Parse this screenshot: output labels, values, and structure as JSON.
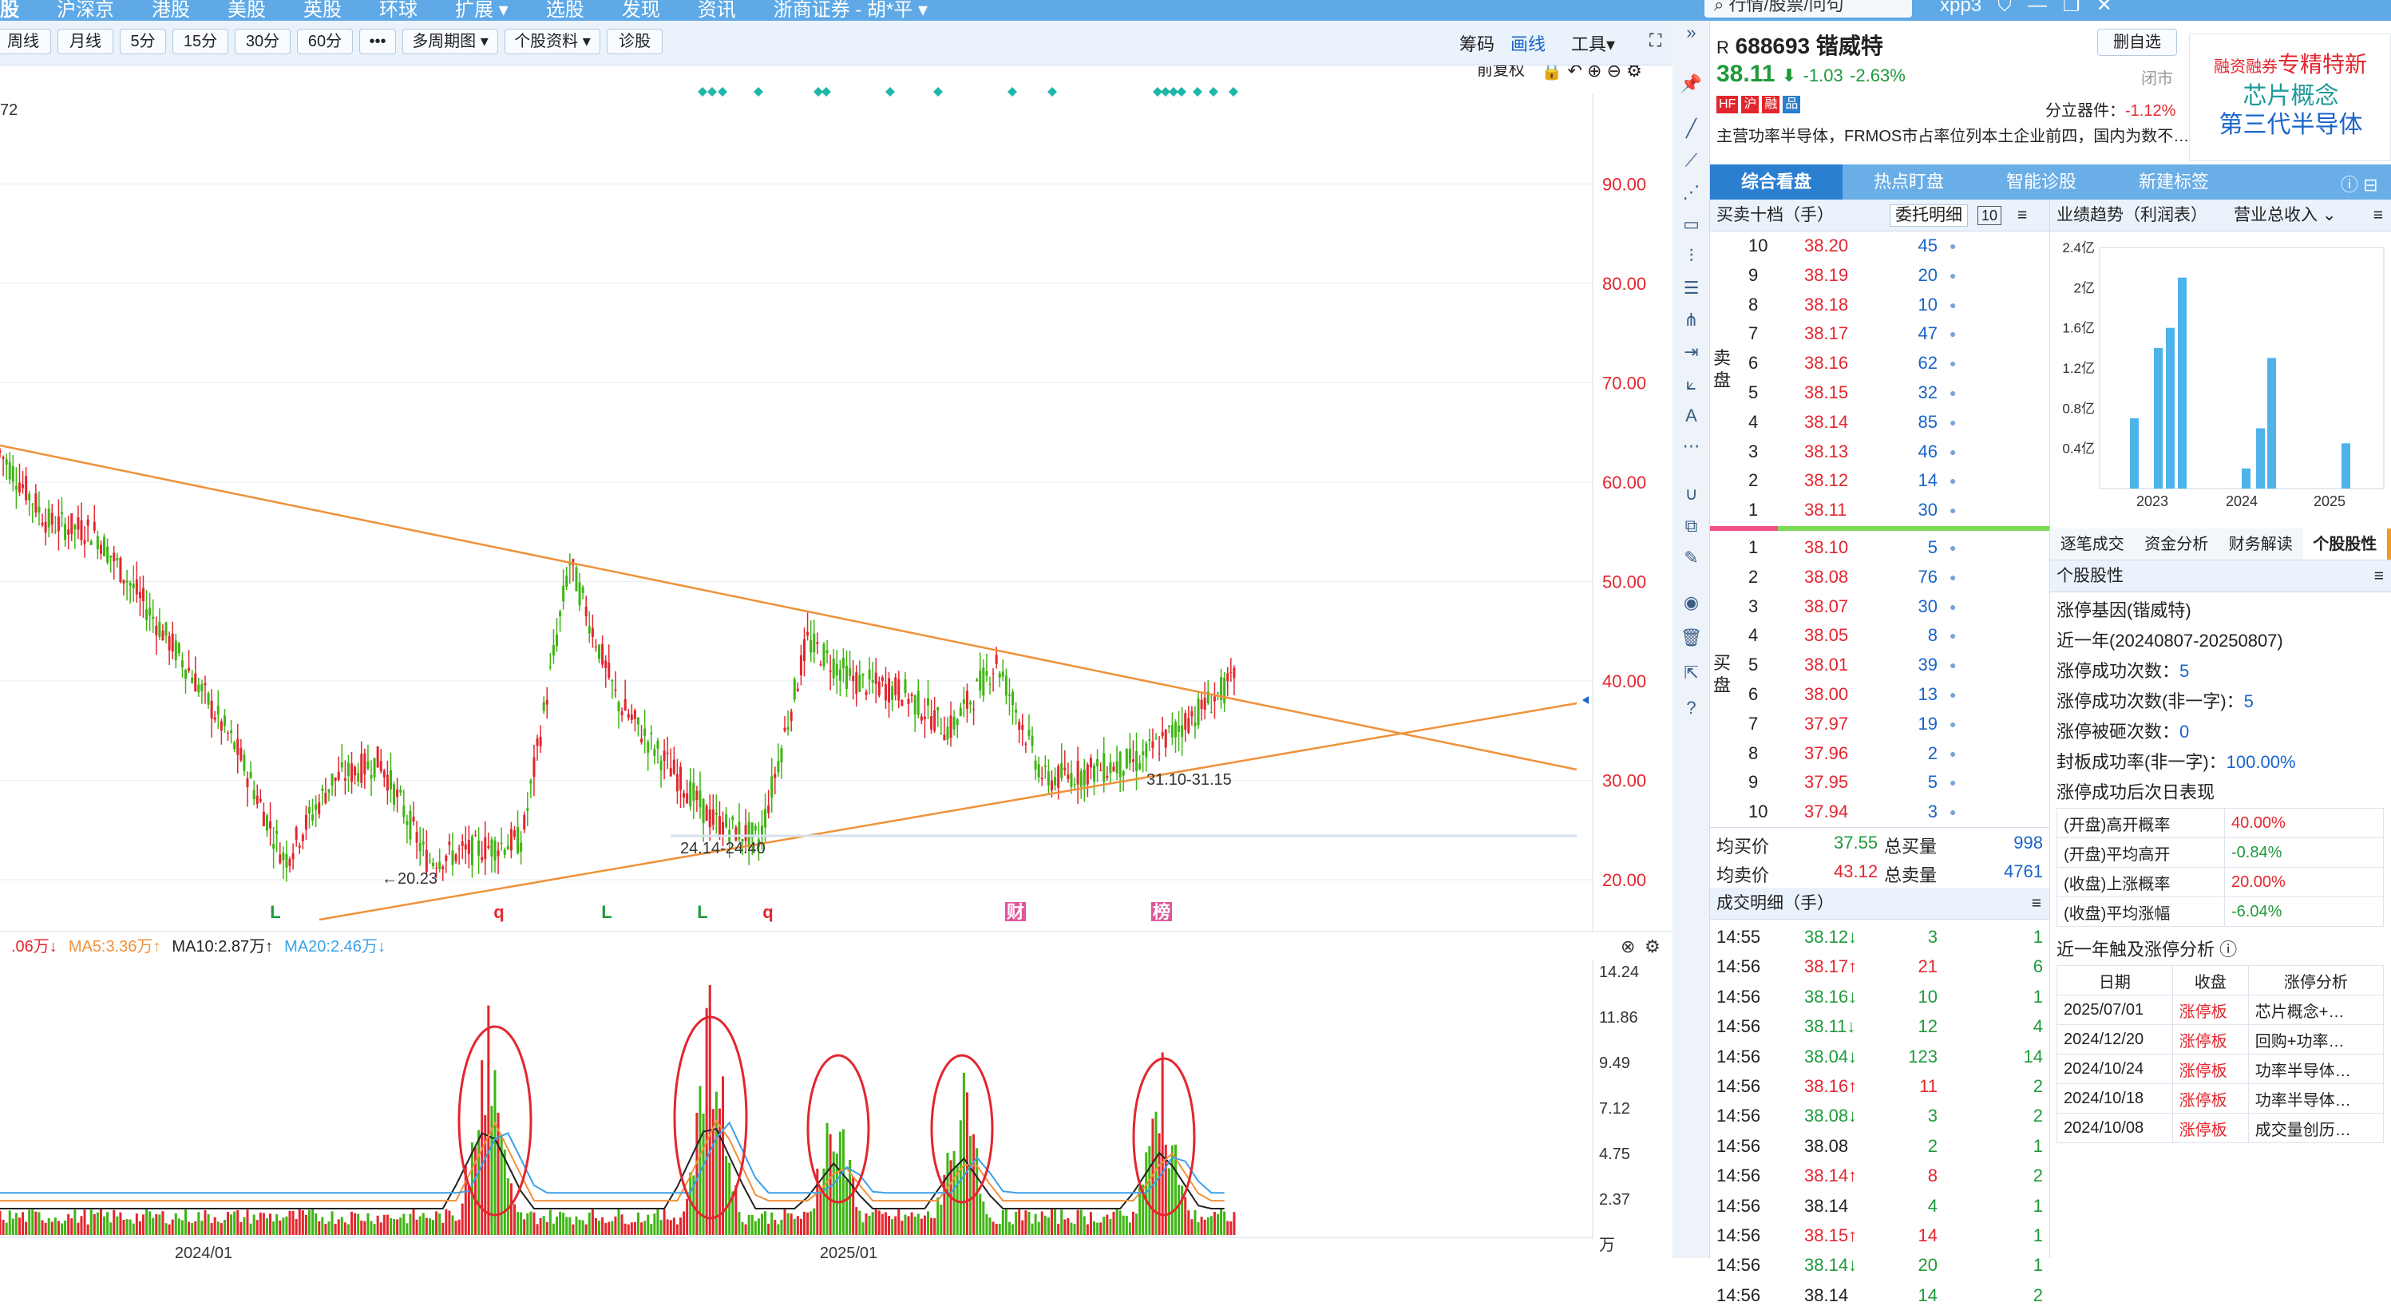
{
  "nav": {
    "items": [
      "股",
      "沪深京",
      "港股",
      "美股",
      "英股",
      "环球",
      "扩展 ▾",
      "选股",
      "发现",
      "资讯",
      "浙商证券 - 胡*平 ▾"
    ],
    "search_placeholder": "行情/股票/问句",
    "user": "xpp3"
  },
  "toolbar": {
    "periods": [
      "周线",
      "月线",
      "5分",
      "15分",
      "30分",
      "60分",
      "•••",
      "多周期图 ▾",
      "个股资料 ▾",
      "诊股"
    ],
    "right": [
      "筹码",
      "画线",
      "工具▾"
    ],
    "restore": "前复权"
  },
  "chart": {
    "top_left_label": "72",
    "price_ticks": [
      "90.00",
      "80.00",
      "70.00",
      "60.00",
      "50.00",
      "40.00",
      "30.00",
      "20.00"
    ],
    "annotations": [
      "←20.23",
      "24.14-24.40",
      "31.10-31.15"
    ],
    "markers": [
      "L",
      "q",
      "L",
      "L",
      "q",
      "财",
      "榜"
    ],
    "ma_text": {
      "a": ".06万↓",
      "ma5": "MA5:3.36万↑",
      "ma10": "MA10:2.87万↑",
      "ma20": "MA20:2.46万↓"
    },
    "vol_ticks": [
      "14.24",
      "11.86",
      "9.49",
      "7.12",
      "4.75",
      "2.37",
      "万"
    ],
    "date_labels": [
      "2024/01",
      "2025/01"
    ]
  },
  "chart_data": {
    "type": "line",
    "title": "",
    "x": [
      "2023-06",
      "2023-07",
      "2023-08",
      "2023-09",
      "2023-10",
      "2023-11",
      "2023-12",
      "2024-01",
      "2024-02",
      "2024-03",
      "2024-04",
      "2024-05",
      "2024-06",
      "2024-07",
      "2024-08",
      "2024-09",
      "2024-10",
      "2024-11",
      "2024-12",
      "2025-01",
      "2025-02",
      "2025-03",
      "2025-04",
      "2025-05",
      "2025-06",
      "2025-07",
      "2025-08"
    ],
    "series": [
      {
        "name": "",
        "values": [
          63,
          56,
          55,
          48,
          41,
          33,
          22,
          30,
          32,
          22,
          23,
          24,
          52,
          38,
          32,
          26,
          24,
          44,
          40,
          39,
          35,
          42,
          30,
          31,
          32,
          36,
          40
        ]
      }
    ],
    "yticks": [
      20,
      30,
      40,
      50,
      60,
      70,
      80,
      90
    ],
    "ylim": [
      17,
      97
    ],
    "volume_max": 14.24
  },
  "stock": {
    "prefix": "R",
    "code": "688693",
    "name": "锴威特",
    "price": "38.11",
    "arrow": "⬇",
    "change": "-1.03",
    "pct": "-2.63%",
    "del_btn": "删自选",
    "closed": "闭市",
    "tags": [
      "HF",
      "沪",
      "融",
      "品"
    ],
    "sector": "分立器件：",
    "sector_pct": "-1.12%",
    "desc": "主营功率半导体，FRMOS市占率位列本土企业前四，国内为数不…",
    "badges": [
      "融资融券",
      "专精特新",
      "芯片概念",
      "第三代半导体"
    ]
  },
  "tabs": [
    "综合看盘",
    "热点盯盘",
    "智能诊股",
    "新建标签"
  ],
  "orderbook": {
    "title": "买卖十档（手）",
    "tab2": "委托明细",
    "num": "10",
    "sell_label": "卖盘",
    "buy_label": "买盘",
    "sells": [
      [
        "10",
        "38.20",
        "45"
      ],
      [
        "9",
        "38.19",
        "20"
      ],
      [
        "8",
        "38.18",
        "10"
      ],
      [
        "7",
        "38.17",
        "47"
      ],
      [
        "6",
        "38.16",
        "62"
      ],
      [
        "5",
        "38.15",
        "32"
      ],
      [
        "4",
        "38.14",
        "85"
      ],
      [
        "3",
        "38.13",
        "46"
      ],
      [
        "2",
        "38.12",
        "14"
      ],
      [
        "1",
        "38.11",
        "30"
      ]
    ],
    "buys": [
      [
        "1",
        "38.10",
        "5"
      ],
      [
        "2",
        "38.08",
        "76"
      ],
      [
        "3",
        "38.07",
        "30"
      ],
      [
        "4",
        "38.05",
        "8"
      ],
      [
        "5",
        "38.01",
        "39"
      ],
      [
        "6",
        "38.00",
        "13"
      ],
      [
        "7",
        "37.97",
        "19"
      ],
      [
        "8",
        "37.96",
        "2"
      ],
      [
        "9",
        "37.95",
        "5"
      ],
      [
        "10",
        "37.94",
        "3"
      ]
    ],
    "avg_buy_label": "均买价",
    "avg_buy": "37.55",
    "tot_buy_label": "总买量",
    "tot_buy": "998",
    "avg_sell_label": "均卖价",
    "avg_sell": "43.12",
    "tot_sell_label": "总卖量",
    "tot_sell": "4761"
  },
  "trades": {
    "title": "成交明细（手）",
    "rows": [
      [
        "14:55",
        "38.12↓",
        "3",
        "1"
      ],
      [
        "14:56",
        "38.17↑",
        "21",
        "6"
      ],
      [
        "14:56",
        "38.16↓",
        "10",
        "1"
      ],
      [
        "14:56",
        "38.11↓",
        "12",
        "4"
      ],
      [
        "14:56",
        "38.04↓",
        "123",
        "14"
      ],
      [
        "14:56",
        "38.16↑",
        "11",
        "2"
      ],
      [
        "14:56",
        "38.08↓",
        "3",
        "2"
      ],
      [
        "14:56",
        "38.08",
        "2",
        "1"
      ],
      [
        "14:56",
        "38.14↑",
        "8",
        "2"
      ],
      [
        "14:56",
        "38.14",
        "4",
        "1"
      ],
      [
        "14:56",
        "38.15↑",
        "14",
        "1"
      ],
      [
        "14:56",
        "38.14↓",
        "20",
        "1"
      ],
      [
        "14:56",
        "38.14",
        "14",
        "2"
      ]
    ]
  },
  "perf": {
    "title": "业绩趋势（利润表）",
    "select": "营业总收入 ⌄",
    "yticks": [
      "2.4亿",
      "2亿",
      "1.6亿",
      "1.2亿",
      "0.8亿",
      "0.4亿"
    ],
    "xlabels": [
      "2023",
      "2024",
      "2025"
    ]
  },
  "perf_values": [
    0.7,
    1.4,
    1.6,
    2.1,
    0.2,
    0.6,
    1.3,
    0.45
  ],
  "subtabs": [
    "逐笔成交",
    "资金分析",
    "财务解读",
    "个股股性"
  ],
  "traits": {
    "title": "个股股性",
    "gene": "涨停基因(锴威特)",
    "period": "近一年(20240807-20250807)",
    "stats": [
      [
        "涨停成功次数：",
        "5"
      ],
      [
        "涨停成功次数(非一字)：",
        "5"
      ],
      [
        "涨停被砸次数：",
        "0"
      ],
      [
        "封板成功率(非一字)：",
        "100.00%"
      ]
    ],
    "next_title": "涨停成功后次日表现",
    "next": [
      [
        "(开盘)高开概率",
        "40.00%",
        "red"
      ],
      [
        "(开盘)平均高开",
        "-0.84%",
        "green"
      ],
      [
        "(收盘)上涨概率",
        "20.00%",
        "red"
      ],
      [
        "(收盘)平均涨幅",
        "-6.04%",
        "green"
      ]
    ],
    "limit_title": "近一年触及涨停分析",
    "limit_head": [
      "日期",
      "收盘",
      "涨停分析"
    ],
    "limit_rows": [
      [
        "2025/07/01",
        "涨停板",
        "芯片概念+…"
      ],
      [
        "2024/12/20",
        "涨停板",
        "回购+功率…"
      ],
      [
        "2024/10/24",
        "涨停板",
        "功率半导体…"
      ],
      [
        "2024/10/18",
        "涨停板",
        "功率半导体…"
      ],
      [
        "2024/10/08",
        "涨停板",
        "成交量创历…"
      ]
    ]
  }
}
